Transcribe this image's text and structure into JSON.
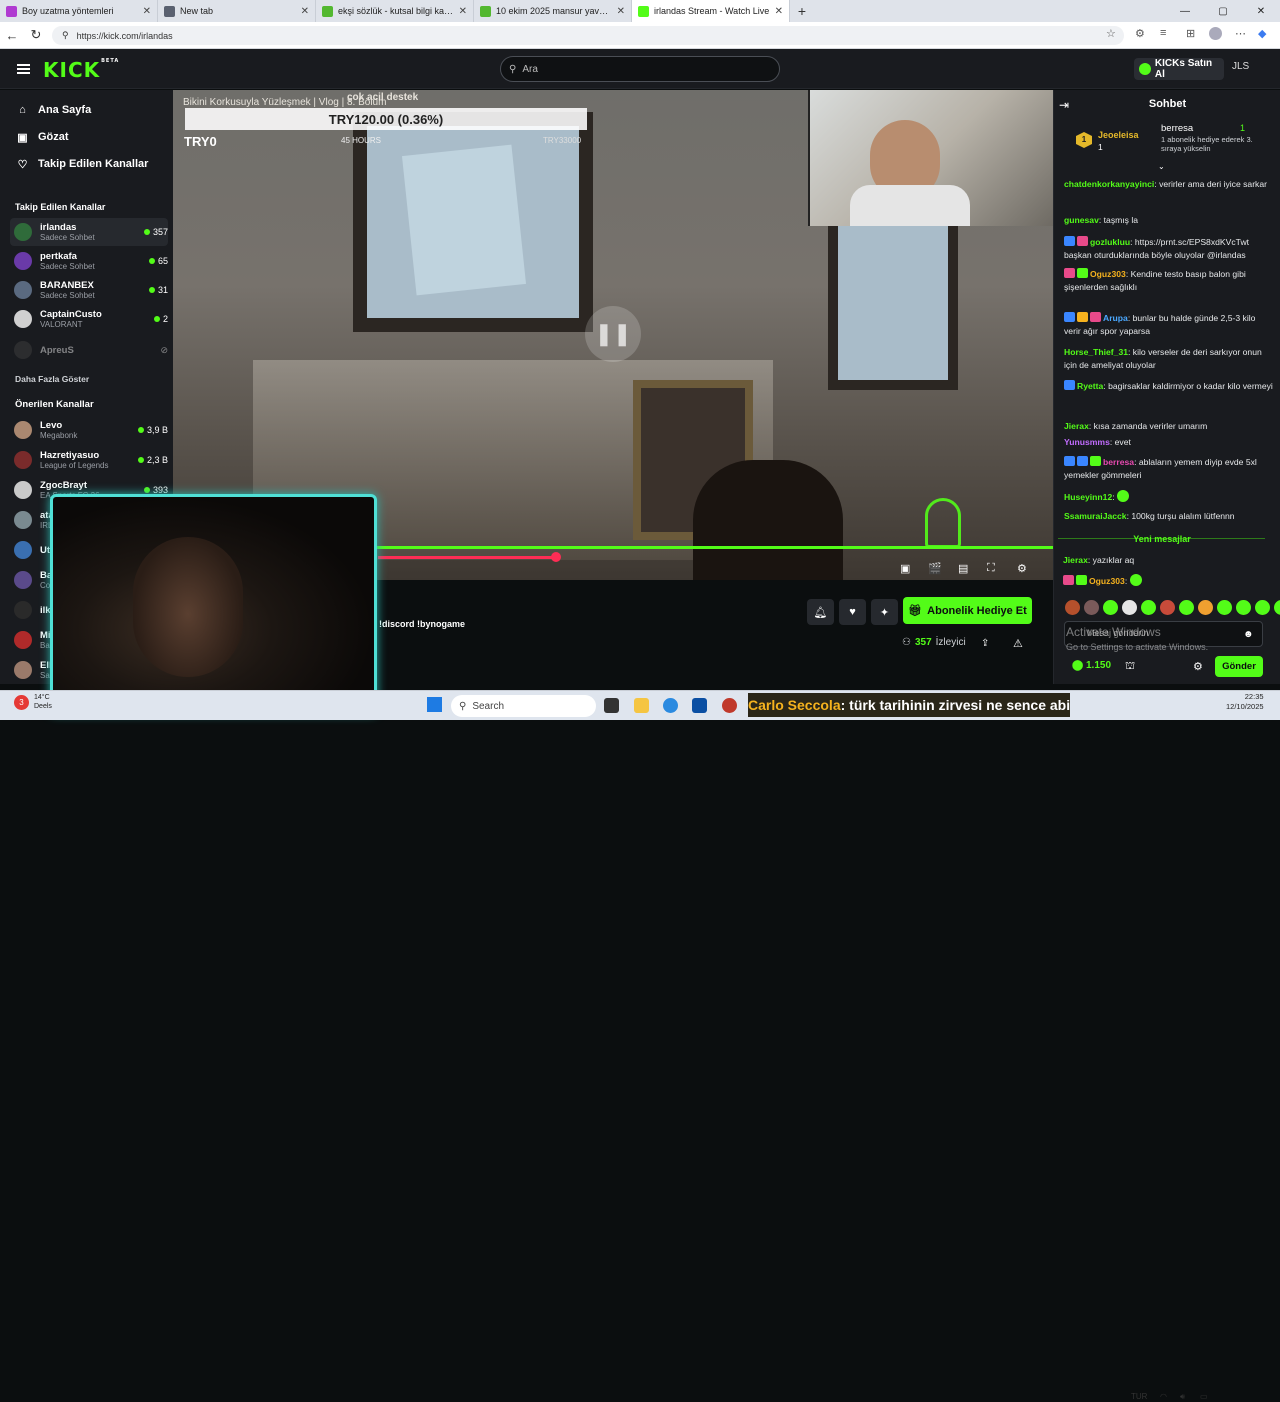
{
  "browser": {
    "tabs": [
      {
        "label": "Boy uzatma yöntemleri",
        "color": "#b03bd1",
        "active": false
      },
      {
        "label": "New tab",
        "color": "#5a6170",
        "active": false
      },
      {
        "label": "ekşi sözlük - kutsal bilgi kaynağı",
        "color": "#53b830",
        "active": false
      },
      {
        "label": "10 ekim 2025 mansur yavaş hakkı",
        "color": "#53b830",
        "active": false
      },
      {
        "label": "irlandas Stream - Watch Live",
        "color": "#53fc18",
        "active": true
      }
    ],
    "url": "https://kick.com/irlandas"
  },
  "header": {
    "logo": "KICK",
    "logo_beta": "BETA",
    "search_placeholder": "Ara",
    "kicks_button": "KICKs Satın Al",
    "user_initials": "JLS"
  },
  "sidebar": {
    "nav": [
      {
        "label": "Ana Sayfa",
        "icon": "home-icon",
        "glyph": "⌂"
      },
      {
        "label": "Gözat",
        "icon": "browse-icon",
        "glyph": "▣"
      },
      {
        "label": "Takip Edilen Kanallar",
        "icon": "heart-icon",
        "glyph": "♡"
      }
    ],
    "followed_heading": "Takip Edilen Kanallar",
    "followed": [
      {
        "name": "irlandas",
        "sub": "Sadece Sohbet",
        "viewers": "357",
        "color": "#2f6b3a"
      },
      {
        "name": "pertkafa",
        "sub": "Sadece Sohbet",
        "viewers": "65",
        "color": "#6a3aa8"
      },
      {
        "name": "BARANBEX",
        "sub": "Sadece Sohbet",
        "viewers": "31",
        "color": "#5a6a80"
      },
      {
        "name": "CaptainCusto",
        "sub": "VALORANT",
        "viewers": "2",
        "color": "#d0d0d0"
      }
    ],
    "offline_channel": "ApreuS",
    "show_more": "Daha Fazla Göster",
    "recommended_heading": "Önerilen Kanallar",
    "recommended": [
      {
        "name": "Levo",
        "sub": "Megabonk",
        "viewers": "3,9 B",
        "color": "#aa8870"
      },
      {
        "name": "Hazretiyasuo",
        "sub": "League of Legends",
        "viewers": "2,3 B",
        "color": "#7a2b2b"
      },
      {
        "name": "ZgocBrayt",
        "sub": "EA Sports FC 26",
        "viewers": "393",
        "color": "#c9c9c9"
      },
      {
        "name": "ata",
        "sub": "IRL",
        "viewers": "",
        "color": "#7a8a90"
      },
      {
        "name": "Ut",
        "sub": "",
        "viewers": "",
        "color": "#3a6fb0"
      },
      {
        "name": "Ba",
        "sub": "Co",
        "viewers": "",
        "color": "#5a4a8a"
      },
      {
        "name": "ilk",
        "sub": "",
        "viewers": "",
        "color": "#2a2a2a"
      },
      {
        "name": "Mi",
        "sub": "Ba",
        "viewers": "",
        "color": "#b02a2a"
      },
      {
        "name": "Ell",
        "sub": "Sa",
        "viewers": "",
        "color": "#9a7a6a"
      }
    ]
  },
  "video": {
    "overlay_title": "Bikini Korkusuyla Yüzleşmek | Vlog | 8. Bölüm",
    "overlay_donation_tag": "çok acil destek",
    "donation_amount": "TRY120.00 (0.36%)",
    "donation_current": "TRY0",
    "donation_hours": "45 HOURS",
    "donation_goal": "TRY33000",
    "progress_fraction": 0.435,
    "stream_title": "!discord !bynogame",
    "viewers": "357",
    "viewers_label": "İzleyici",
    "subscribe_button": "Abonelik Hediye Et"
  },
  "chat": {
    "title": "Sohbet",
    "pinned": {
      "rank_user": "Jeoeleisa",
      "rank_count": "1",
      "gifter": "berresa",
      "gifter_count": "1",
      "gift_text": "1 abonelik hediye ederek 3. sıraya yükselin"
    },
    "messages": [
      {
        "user": "chatdenkorkanyayinci",
        "color": "#53fc18",
        "text": "verirler ama deri iyice sarkar",
        "badges": []
      },
      {
        "user": "gunesav",
        "color": "#53fc18",
        "text": "taşmış la",
        "badges": []
      },
      {
        "user": "gozlukluu",
        "color": "#53fc18",
        "text": "https://prnt.sc/EPS8xdKVcTwt başkan oturduklarında böyle oluyolar @irlandas",
        "badges": [
          "#3a86ff",
          "#e84a8a"
        ]
      },
      {
        "user": "Oguz303",
        "color": "#f5b21e",
        "text": "Kendine testo basıp balon gibi şişenlerden sağlıklı",
        "badges": [
          "#e84a8a",
          "#53fc18"
        ]
      },
      {
        "user": "Arupa",
        "color": "#4aa8ff",
        "text": "bunlar bu halde günde 2,5-3 kilo verir ağır spor yaparsa",
        "badges": [
          "#3a86ff",
          "#f5b21e",
          "#e84a8a"
        ]
      },
      {
        "user": "Horse_Thief_31",
        "color": "#53fc18",
        "text": "kilo verseler de deri sarkıyor onun için de ameliyat oluyolar",
        "badges": []
      },
      {
        "user": "Ryetta",
        "color": "#53fc18",
        "text": "bagirsaklar kaldirmiyor o kadar kilo vermeyi",
        "badges": [
          "#3a86ff"
        ]
      },
      {
        "user": "Jierax",
        "color": "#53fc18",
        "text": "kısa zamanda verirler umarım",
        "badges": []
      },
      {
        "user": "Yunusmms",
        "color": "#c26cff",
        "text": "evet",
        "badges": []
      },
      {
        "user": "berresa",
        "color": "#e84ab0",
        "text": "ablaların yemem diyip evde 5xl yemekler gömmeleri",
        "badges": [
          "#3a86ff",
          "#3a86ff",
          "#53fc18"
        ]
      },
      {
        "user": "Huseyinn12",
        "color": "#53fc18",
        "text": "",
        "badges": []
      },
      {
        "user": "SsamuraiJacck",
        "color": "#53fc18",
        "text": "100kg turşu alalım lütfennn",
        "badges": []
      }
    ],
    "new_messages_label": "Yeni mesajlar",
    "after_messages": [
      {
        "user": "Jierax",
        "color": "#53fc18",
        "text": "yazıklar aq",
        "badges": []
      },
      {
        "user": "Oguz303",
        "color": "#f5b21e",
        "text": "",
        "badges": [
          "#e84a8a",
          "#53fc18"
        ]
      }
    ],
    "input_placeholder": "Mesaj gönderin",
    "activate_windows_title": "Activate Windows",
    "activate_windows_sub": "Go to Settings to activate Windows.",
    "kicks_balance": "1.150",
    "send_button": "Gönder"
  },
  "taskbar": {
    "weather_temp": "14°C",
    "weather_text": "Deels",
    "search_placeholder": "Search",
    "ticker_name": "Carlo Seccola",
    "ticker_text": ": türk tarihinin zirvesi ne sence abi",
    "language": "TUR",
    "time": "22:35",
    "date": "12/10/2025"
  }
}
